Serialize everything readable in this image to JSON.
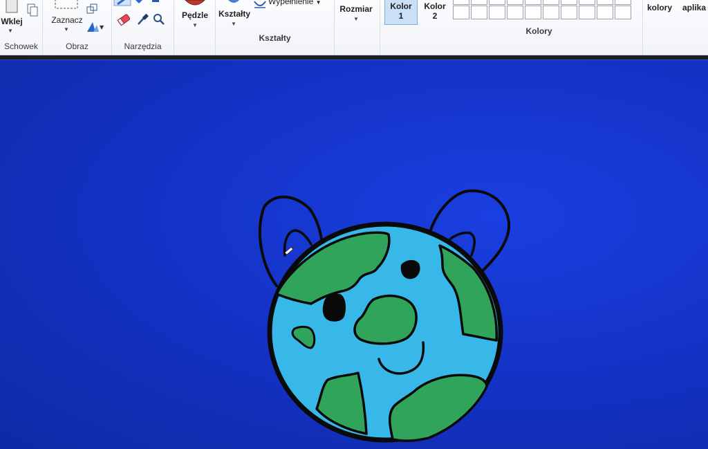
{
  "ribbon": {
    "schowek": {
      "group_label": "Schowek",
      "paste_label": "Wklej"
    },
    "obraz": {
      "group_label": "Obraz",
      "select_label": "Zaznacz"
    },
    "narzedzia": {
      "group_label": "Narzędzia"
    },
    "pedzle": {
      "label": "Pędzle"
    },
    "ksztalty": {
      "group_label": "Kształty",
      "shapes_label": "Kształty",
      "fill_label": "Wypełnienie"
    },
    "rozmiar": {
      "label": "Rozmiar"
    },
    "kolory": {
      "group_label": "Kolory",
      "kolor1_line1": "Kolor",
      "kolor1_line2": "1",
      "kolor2_line1": "Kolor",
      "kolor2_line2": "2",
      "edit_colors_label": "kolory",
      "apps_label": "aplika"
    }
  },
  "colors": {
    "canvas_bg": "#1433c8",
    "ocean": "#38b8e8",
    "land": "#2fa45a",
    "outline": "#0a0a0a"
  }
}
